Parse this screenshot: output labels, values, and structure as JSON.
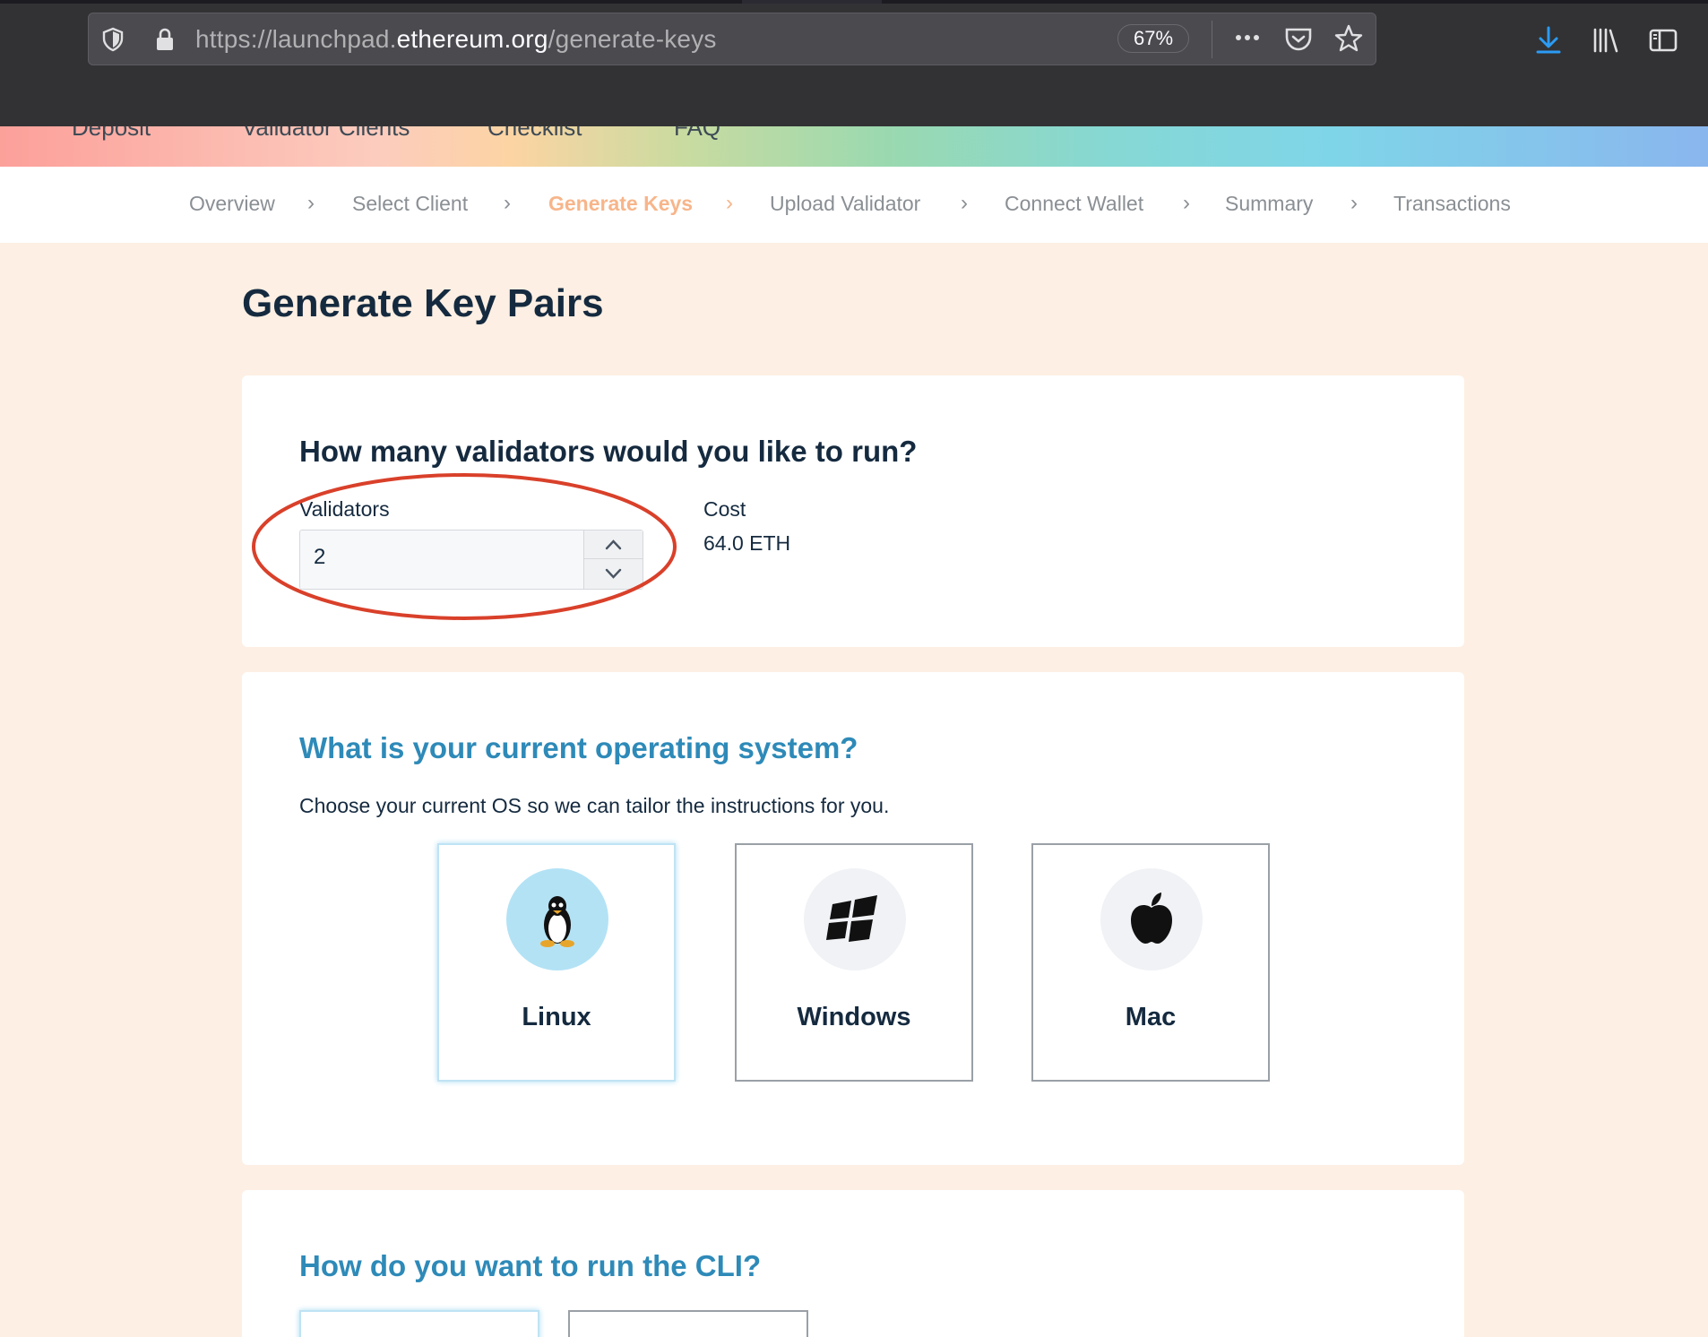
{
  "browser": {
    "url_prefix": "https://launchpad.",
    "url_domain": "ethereum.org",
    "url_path": "/generate-keys",
    "zoom": "67%",
    "icons": {
      "shield": "shield-icon",
      "lock": "lock-icon",
      "more": "more-icon",
      "pocket": "pocket-icon",
      "bookmark": "star-icon",
      "download": "download-icon",
      "library": "library-icon",
      "sidebar": "sidebar-icon"
    },
    "accent": "#2b9bf4"
  },
  "site_nav": [
    "Deposit",
    "Validator Clients",
    "Checklist",
    "FAQ"
  ],
  "steps": [
    {
      "label": "Overview",
      "active": false
    },
    {
      "label": "Select Client",
      "active": false
    },
    {
      "label": "Generate Keys",
      "active": true
    },
    {
      "label": "Upload Validator",
      "active": false
    },
    {
      "label": "Connect Wallet",
      "active": false
    },
    {
      "label": "Summary",
      "active": false
    },
    {
      "label": "Transactions",
      "active": false
    }
  ],
  "page_title": "Generate Key Pairs",
  "validators_card": {
    "question": "How many validators would you like to run?",
    "validators_label": "Validators",
    "validators_value": "2",
    "cost_label": "Cost",
    "cost_value": "64.0 ETH",
    "annotation_color": "#d9402a"
  },
  "os_card": {
    "question": "What is your current operating system?",
    "subtitle": "Choose your current OS so we can tailor the instructions for you.",
    "options": [
      {
        "name": "Linux",
        "icon": "linux-icon",
        "selected": true
      },
      {
        "name": "Windows",
        "icon": "windows-icon",
        "selected": false
      },
      {
        "name": "Mac",
        "icon": "apple-icon",
        "selected": false
      }
    ]
  },
  "cli_card": {
    "question": "How do you want to run the CLI?"
  },
  "colors": {
    "active_step": "#f7b58a",
    "heading_blue": "#2e8ab8",
    "heading_dark": "#152a3f",
    "background": "#fdefe3"
  }
}
